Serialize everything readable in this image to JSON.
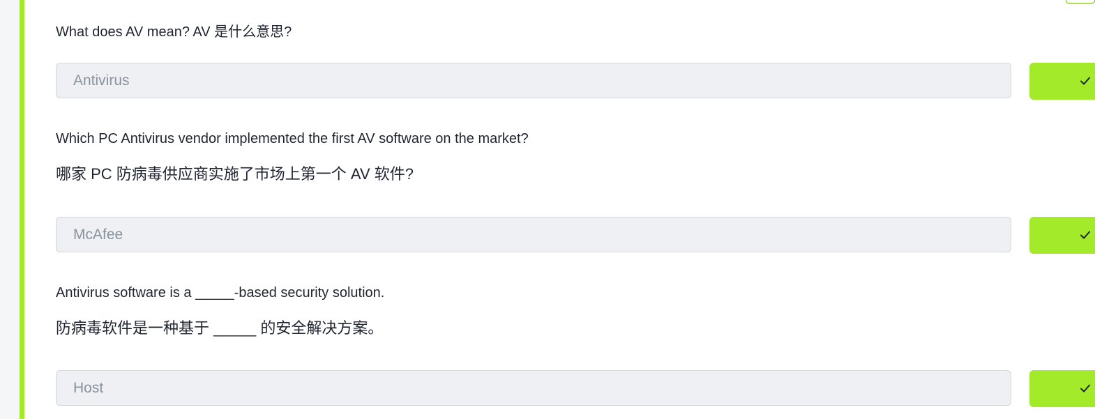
{
  "questions": [
    {
      "text_en": "What does AV mean? AV 是什么意思?",
      "answer_value": "Antivirus"
    },
    {
      "text_en": "Which PC Antivirus vendor implemented the first AV software on the market?",
      "text_zh": "哪家 PC 防病毒供应商实施了市场上第一个 AV 软件?",
      "answer_value": "McAfee"
    },
    {
      "text_en": "Antivirus software is a _____-based security solution.",
      "text_zh": "防病毒软件是一种基于 _____ 的安全解决方案。",
      "answer_value": "Host"
    }
  ],
  "icons": {
    "submit": "check-icon"
  },
  "colors": {
    "accent": "#a3ea2a",
    "input_bg": "#eef0f3",
    "input_text": "#8a929d",
    "text": "#1f2430"
  }
}
